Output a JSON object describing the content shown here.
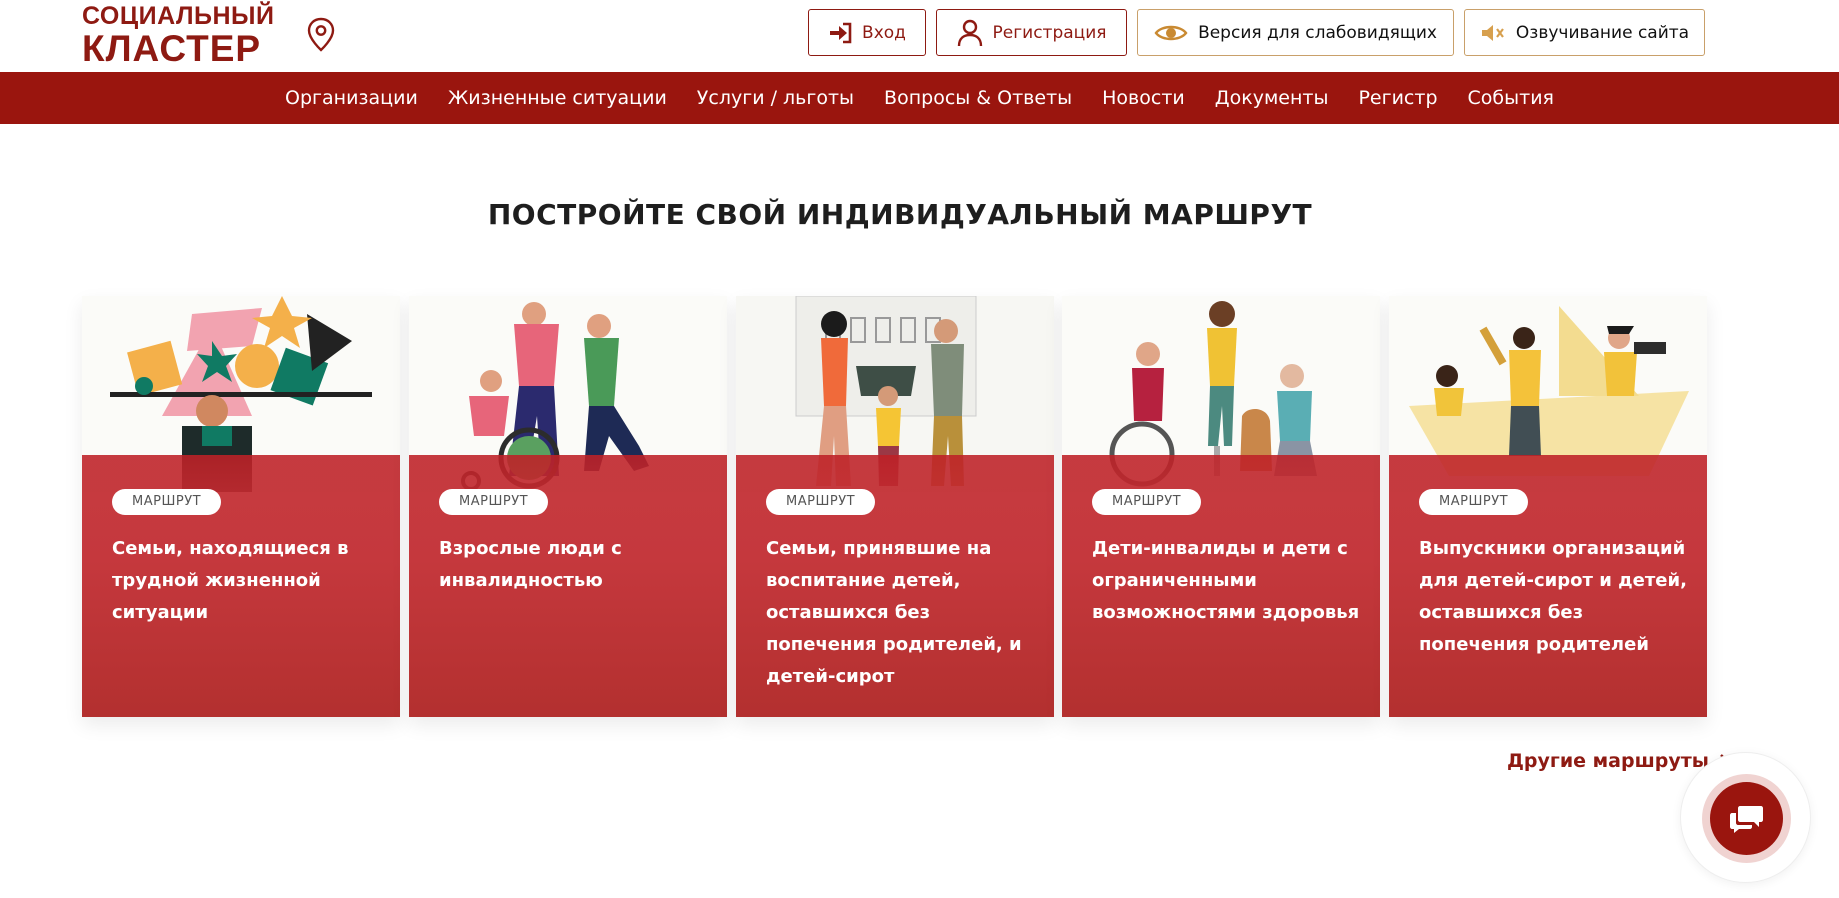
{
  "header": {
    "logo_line1": "СОЦИАЛЬНЫЙ",
    "logo_line2": "КЛАСТЕР",
    "login_label": "Вход",
    "register_label": "Регистрация",
    "low_vision_label": "Версия для слабовидящих",
    "voice_label": "Озвучивание сайта",
    "icons": [
      "map-pin-icon",
      "login-icon",
      "user-icon",
      "eye-icon",
      "speaker-muted-icon"
    ]
  },
  "nav": {
    "items": [
      {
        "label": "Организации"
      },
      {
        "label": "Жизненные ситуации"
      },
      {
        "label": "Услуги / льготы"
      },
      {
        "label": "Вопросы & Ответы"
      },
      {
        "label": "Новости"
      },
      {
        "label": "Документы"
      },
      {
        "label": "Регистр"
      },
      {
        "label": "События"
      }
    ]
  },
  "main": {
    "title": "ПОСТРОЙТЕ СВОЙ ИНДИВИДУАЛЬНЫЙ МАРШРУТ",
    "cards": [
      {
        "badge": "МАРШРУТ",
        "title": "Семьи, находящиеся в трудной жизненной ситуации"
      },
      {
        "badge": "МАРШРУТ",
        "title": "Взрослые люди с инвалидностью"
      },
      {
        "badge": "МАРШРУТ",
        "title": "Семьи, принявшие на воспитание детей, оставшихся без попечения родителей, и детей-сирот"
      },
      {
        "badge": "МАРШРУТ",
        "title": "Дети-инвалиды и дети с ограниченными возможностями здоровья"
      },
      {
        "badge": "МАРШРУТ",
        "title": "Выпускники организаций для детей-сирот и детей, оставшихся без попечения родителей"
      }
    ],
    "more_link": "Другие маршруты"
  },
  "colors": {
    "brand_dark_red": "#9a150e",
    "card_red": "#c5383d",
    "gold_border": "#c9a06a"
  }
}
